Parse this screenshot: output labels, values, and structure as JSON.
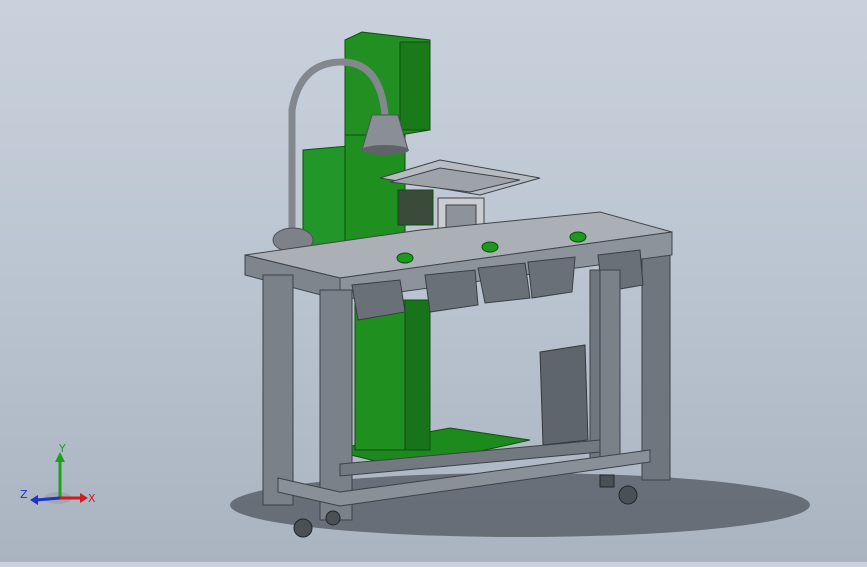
{
  "viewport": {
    "background_top": "#c9d2dc",
    "background_bottom": "#aab4c1",
    "model_colors": {
      "press_body": "#1f8f1f",
      "press_body_dark": "#146b14",
      "frame": "#7c838c",
      "frame_dark": "#4d5259",
      "table_top": "#a9aeb4",
      "bins": "#6d7279",
      "lamp": "#8a8f95",
      "buttons": "#1d9a1d"
    }
  },
  "triad": {
    "x_label": "X",
    "y_label": "Y",
    "z_label": "Z",
    "x_color": "#d01c1c",
    "y_color": "#1aa31a",
    "z_color": "#1c34c8"
  }
}
